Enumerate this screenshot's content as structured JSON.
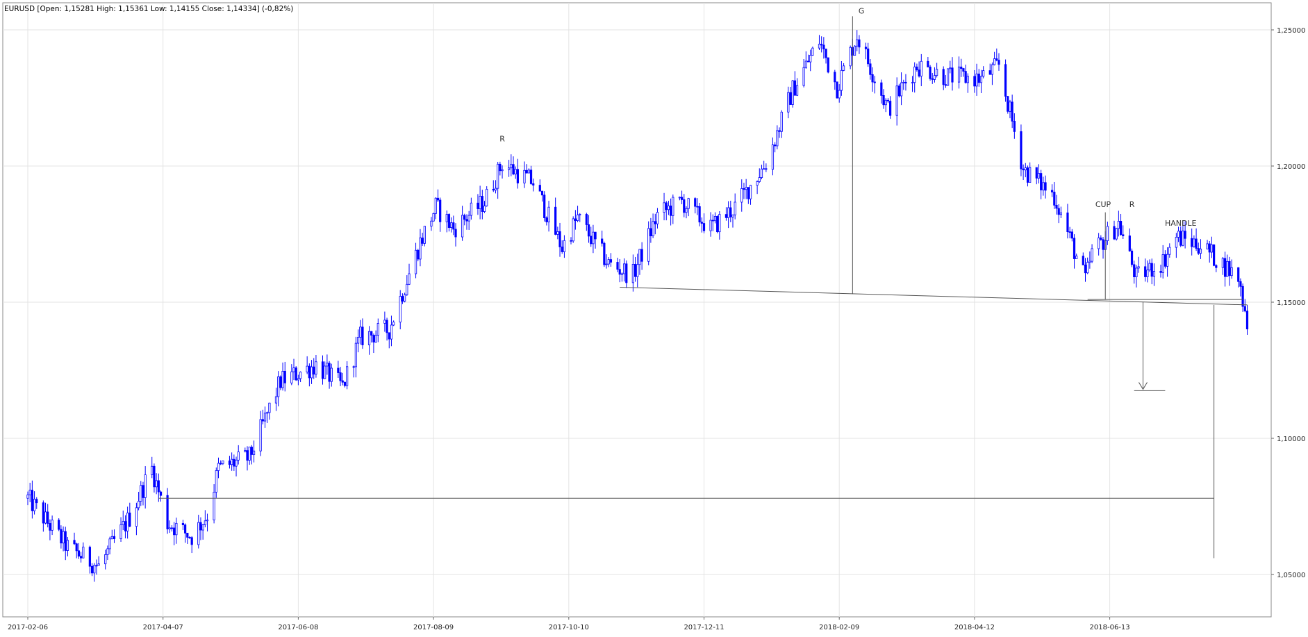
{
  "header": {
    "text": "EURUSD [Open: 1,15281  High: 1,15361  Low: 1,14155  Close: 1,14334]  (-0,82%)"
  },
  "chart_data": {
    "type": "candlestick",
    "symbol": "EURUSD",
    "ohlc_last": {
      "open": 1.15281,
      "high": 1.15361,
      "low": 1.14155,
      "close": 1.14334,
      "change_pct": -0.82
    },
    "x_tick_labels": [
      "2017-02-06",
      "2017-04-07",
      "2017-06-08",
      "2017-08-09",
      "2017-10-10",
      "2017-12-11",
      "2018-02-09",
      "2018-04-12",
      "2018-06-13"
    ],
    "y_tick_labels": [
      "1,25000",
      "1,20000",
      "1,15000",
      "1,10000",
      "1,05000"
    ],
    "ylim": [
      1.046,
      1.259
    ],
    "grid": true,
    "price_path": [
      {
        "d": "2017-02-06",
        "p": 1.078
      },
      {
        "d": "2017-02-24",
        "p": 1.06
      },
      {
        "d": "2017-03-10",
        "p": 1.053
      },
      {
        "d": "2017-03-24",
        "p": 1.071
      },
      {
        "d": "2017-03-31",
        "p": 1.084
      },
      {
        "d": "2017-04-03",
        "p": 1.089
      },
      {
        "d": "2017-04-10",
        "p": 1.069
      },
      {
        "d": "2017-04-21",
        "p": 1.064
      },
      {
        "d": "2017-04-28",
        "p": 1.072
      },
      {
        "d": "2017-05-03",
        "p": 1.089
      },
      {
        "d": "2017-05-17",
        "p": 1.093
      },
      {
        "d": "2017-05-31",
        "p": 1.121
      },
      {
        "d": "2017-06-16",
        "p": 1.127
      },
      {
        "d": "2017-06-28",
        "p": 1.119
      },
      {
        "d": "2017-07-06",
        "p": 1.137
      },
      {
        "d": "2017-07-19",
        "p": 1.14
      },
      {
        "d": "2017-08-02",
        "p": 1.172
      },
      {
        "d": "2017-08-09",
        "p": 1.185
      },
      {
        "d": "2017-08-17",
        "p": 1.177
      },
      {
        "d": "2017-08-31",
        "p": 1.187
      },
      {
        "d": "2017-09-08",
        "p": 1.201
      },
      {
        "d": "2017-09-22",
        "p": 1.194
      },
      {
        "d": "2017-10-05",
        "p": 1.17
      },
      {
        "d": "2017-10-12",
        "p": 1.181
      },
      {
        "d": "2017-10-26",
        "p": 1.164
      },
      {
        "d": "2017-11-06",
        "p": 1.16
      },
      {
        "d": "2017-11-17",
        "p": 1.182
      },
      {
        "d": "2017-11-28",
        "p": 1.187
      },
      {
        "d": "2017-12-11",
        "p": 1.177
      },
      {
        "d": "2017-12-22",
        "p": 1.185
      },
      {
        "d": "2018-01-05",
        "p": 1.201
      },
      {
        "d": "2018-01-17",
        "p": 1.228
      },
      {
        "d": "2018-01-29",
        "p": 1.246
      },
      {
        "d": "2018-02-06",
        "p": 1.229
      },
      {
        "d": "2018-02-15",
        "p": 1.248
      },
      {
        "d": "2018-03-01",
        "p": 1.221
      },
      {
        "d": "2018-03-14",
        "p": 1.237
      },
      {
        "d": "2018-03-27",
        "p": 1.233
      },
      {
        "d": "2018-04-12",
        "p": 1.232
      },
      {
        "d": "2018-04-20",
        "p": 1.237
      },
      {
        "d": "2018-05-01",
        "p": 1.199
      },
      {
        "d": "2018-05-15",
        "p": 1.189
      },
      {
        "d": "2018-05-29",
        "p": 1.158
      },
      {
        "d": "2018-06-01",
        "p": 1.168
      },
      {
        "d": "2018-06-13",
        "p": 1.179
      },
      {
        "d": "2018-06-21",
        "p": 1.159
      },
      {
        "d": "2018-07-03",
        "p": 1.165
      },
      {
        "d": "2018-07-09",
        "p": 1.174
      },
      {
        "d": "2018-07-20",
        "p": 1.171
      },
      {
        "d": "2018-08-06",
        "p": 1.159
      },
      {
        "d": "2018-08-10",
        "p": 1.143
      }
    ],
    "annotations": [
      {
        "text": "R",
        "date": "2017-09-08",
        "price": 1.209
      },
      {
        "text": "G",
        "date": "2018-02-17",
        "price": 1.256
      },
      {
        "text": "CUP",
        "date": "2018-06-06",
        "price": 1.185
      },
      {
        "text": "R",
        "date": "2018-06-19",
        "price": 1.185
      },
      {
        "text": "HANDLE",
        "date": "2018-07-11",
        "price": 1.178
      }
    ],
    "lines": [
      {
        "from": {
          "d": "2017-04-06",
          "p": 1.078
        },
        "to": {
          "d": "2018-07-26",
          "p": 1.078
        }
      },
      {
        "from": {
          "d": "2017-10-31",
          "p": 1.1555
        },
        "to": {
          "d": "2018-08-10",
          "p": 1.149
        }
      },
      {
        "from": {
          "d": "2018-05-30",
          "p": 1.151
        },
        "to": {
          "d": "2018-08-08",
          "p": 1.151
        }
      },
      {
        "from": {
          "d": "2018-02-13",
          "p": 1.255
        },
        "to": {
          "d": "2018-02-13",
          "p": 1.153
        }
      },
      {
        "from": {
          "d": "2018-06-07",
          "p": 1.183
        },
        "to": {
          "d": "2018-06-07",
          "p": 1.151
        }
      },
      {
        "from": {
          "d": "2018-06-24",
          "p": 1.15
        },
        "to": {
          "d": "2018-06-24",
          "p": 1.118
        }
      },
      {
        "from": {
          "d": "2018-06-20",
          "p": 1.1175
        },
        "to": {
          "d": "2018-07-04",
          "p": 1.1175
        }
      },
      {
        "from": {
          "d": "2018-07-26",
          "p": 1.149
        },
        "to": {
          "d": "2018-07-26",
          "p": 1.056
        }
      }
    ],
    "colors": {
      "candle": "#0000ff",
      "grid": "#e3e3e3",
      "annotation_line": "#555555"
    }
  }
}
